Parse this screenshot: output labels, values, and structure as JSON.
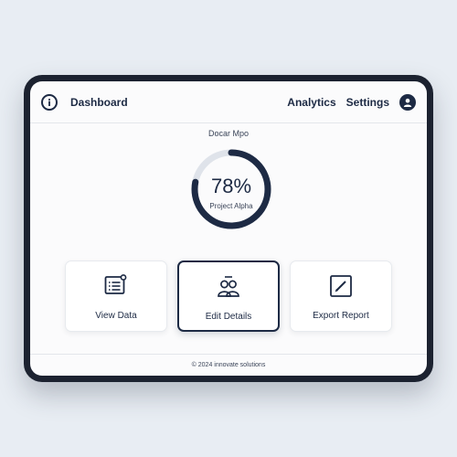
{
  "header": {
    "title": "Dashboard",
    "nav": [
      "Analytics",
      "Settings"
    ]
  },
  "widget": {
    "title": "Docar Mpo",
    "value_text": "78%",
    "label": "Project Alpha",
    "progress": 0.78
  },
  "cards": [
    {
      "label": "View Data",
      "icon": "list-data-icon"
    },
    {
      "label": "Edit Details",
      "icon": "users-icon",
      "active": true
    },
    {
      "label": "Export Report",
      "icon": "edit-export-icon"
    }
  ],
  "footer": {
    "text": "© 2024 innovate solutions"
  },
  "colors": {
    "accent": "#1d2a44",
    "track": "#dfe3ea",
    "background": "#e8edf3"
  }
}
